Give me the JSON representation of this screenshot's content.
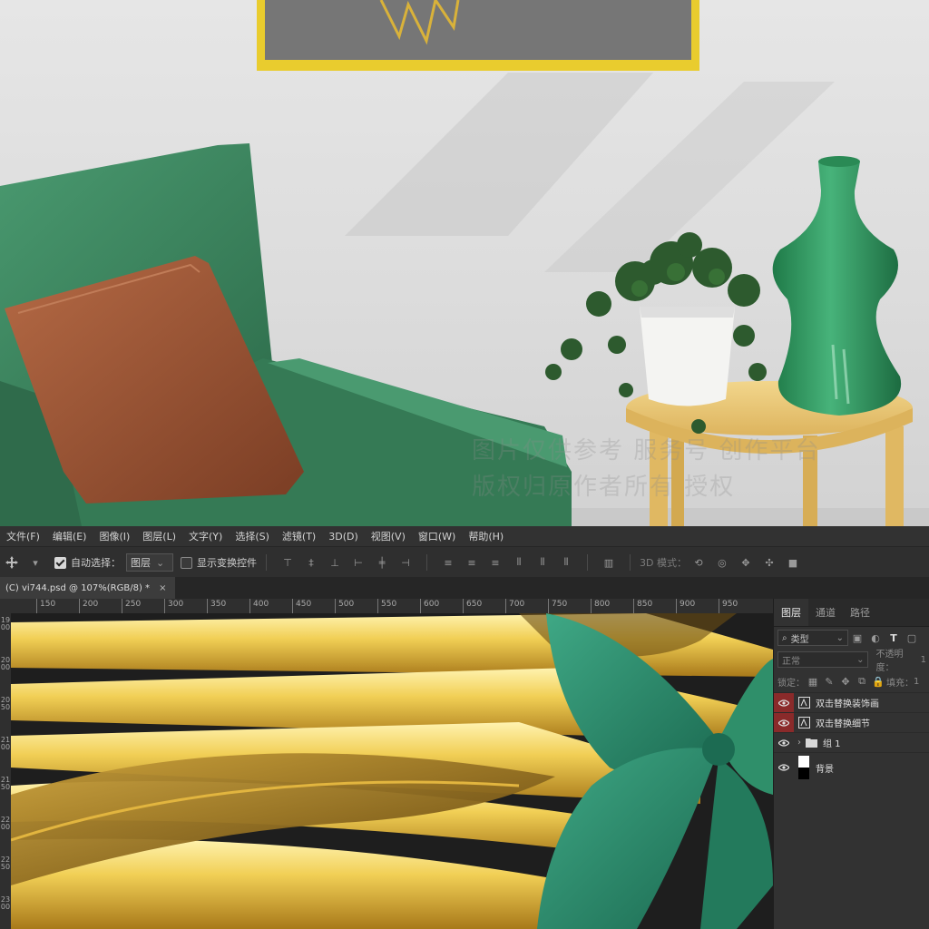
{
  "watermark": {
    "line1": "图片仅供参考 服务号 创作平台",
    "line2": "版权归原作者所有 授权"
  },
  "menu": [
    "文件(F)",
    "编辑(E)",
    "图像(I)",
    "图层(L)",
    "文字(Y)",
    "选择(S)",
    "滤镜(T)",
    "3D(D)",
    "视图(V)",
    "窗口(W)",
    "帮助(H)"
  ],
  "options": {
    "auto_select_label": "自动选择：",
    "auto_select_checked": true,
    "auto_select_target": "图层",
    "show_transform_label": "显示变换控件",
    "show_transform_checked": false,
    "mode_3d_label": "3D 模式："
  },
  "document": {
    "tab_title": "(C) vi744.psd @ 107%(RGB/8) *",
    "close_glyph": "×"
  },
  "ruler": {
    "h_labels": [
      "150",
      "200",
      "250",
      "300",
      "350",
      "400",
      "450",
      "500",
      "550",
      "600",
      "650",
      "700",
      "750",
      "800",
      "850",
      "900",
      "950"
    ],
    "v_labels": [
      "1900",
      "2000",
      "2050",
      "2100",
      "2150",
      "2200",
      "2250",
      "2300"
    ]
  },
  "layers_panel": {
    "tabs": [
      "图层",
      "通道",
      "路径"
    ],
    "active_tab": "图层",
    "filter_label": "类型",
    "blend_mode": "正常",
    "opacity_label": "不透明度：",
    "opacity_value": "1",
    "lock_label": "锁定：",
    "fill_label": "填充：",
    "fill_value": "1",
    "layers": [
      {
        "name": "双击替换装饰画",
        "type": "smart",
        "visible": true,
        "highlight": true
      },
      {
        "name": "双击替换细节",
        "type": "smart",
        "visible": true,
        "highlight": true
      },
      {
        "name": "组 1",
        "type": "group",
        "visible": true,
        "highlight": false
      },
      {
        "name": "背景",
        "type": "background",
        "visible": true,
        "highlight": false
      }
    ]
  },
  "colors": {
    "armchair": "#3e8a62",
    "pillow": "#9a5236",
    "vase": "#2e9a60",
    "table": "#ecc978",
    "frame": "#e9cc2e",
    "layer_highlight": "#8a2a2a"
  }
}
